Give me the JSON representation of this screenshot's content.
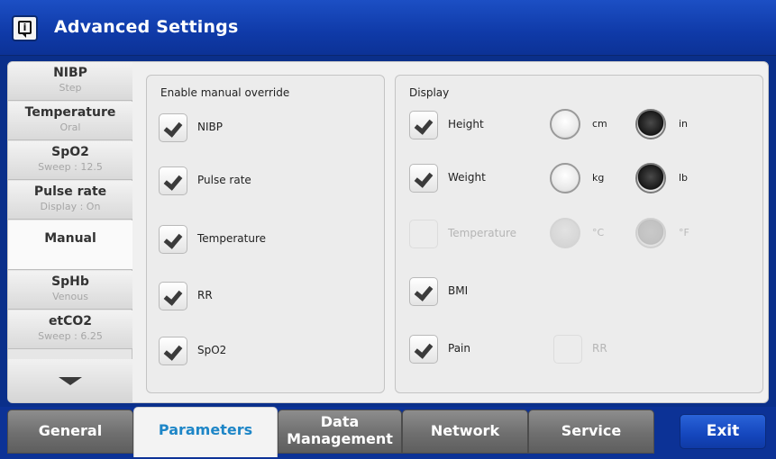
{
  "header": {
    "title": "Advanced Settings",
    "icon": "info-icon"
  },
  "sidebar": {
    "items": [
      {
        "label": "NIBP",
        "sub": "Step"
      },
      {
        "label": "Temperature",
        "sub": "Oral"
      },
      {
        "label": "SpO2",
        "sub": "Sweep : 12.5"
      },
      {
        "label": "Pulse rate",
        "sub": "Display : On"
      },
      {
        "label": "Manual",
        "sub": "",
        "selected": true
      },
      {
        "label": "SpHb",
        "sub": "Venous"
      },
      {
        "label": "etCO2",
        "sub": "Sweep : 6.25"
      }
    ],
    "scroll_icon": "chevron-down-icon"
  },
  "override_panel": {
    "title": "Enable manual override",
    "items": [
      {
        "label": "NIBP",
        "checked": true
      },
      {
        "label": "Pulse rate",
        "checked": true
      },
      {
        "label": "Temperature",
        "checked": true
      },
      {
        "label": "RR",
        "checked": true
      },
      {
        "label": "SpO2",
        "checked": true
      }
    ]
  },
  "display_panel": {
    "title": "Display",
    "items": [
      {
        "label": "Height",
        "checked": true,
        "enabled": true,
        "unit_a": "cm",
        "unit_b": "in",
        "selected_unit": "in"
      },
      {
        "label": "Weight",
        "checked": true,
        "enabled": true,
        "unit_a": "kg",
        "unit_b": "lb",
        "selected_unit": "lb"
      },
      {
        "label": "Temperature",
        "checked": false,
        "enabled": false,
        "unit_a": "°C",
        "unit_b": "°F",
        "selected_unit": "°F"
      },
      {
        "label": "BMI",
        "checked": true,
        "enabled": true
      },
      {
        "label": "Pain",
        "checked": true,
        "enabled": true
      }
    ],
    "rr": {
      "label": "RR",
      "checked": false,
      "enabled": false
    }
  },
  "tabs": [
    {
      "label": "General",
      "active": false
    },
    {
      "label": "Parameters",
      "active": true
    },
    {
      "label": "Data",
      "label2": "Management",
      "active": false
    },
    {
      "label": "Network",
      "active": false
    },
    {
      "label": "Service",
      "active": false
    }
  ],
  "exit_label": "Exit",
  "colors": {
    "header_blue": "#1c4fc4",
    "active_tab_text": "#1e86c7",
    "checkmark": "#3b3b3b"
  }
}
